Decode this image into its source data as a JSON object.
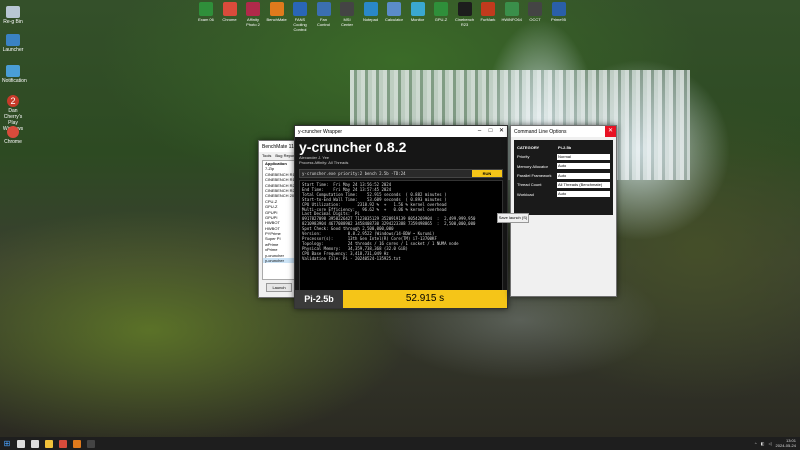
{
  "desktop": {
    "left_icons": [
      {
        "label": "Re-g Bin",
        "icon": "recycle-bin-icon",
        "color": "#b8c7d4"
      },
      {
        "label": "Launcher",
        "icon": "launcher-icon",
        "color": "#3a82c4"
      },
      {
        "label": "Notification",
        "icon": "notification-icon",
        "color": "#4a9ed6"
      },
      {
        "label": "Dan Cherry's Play Windows 2",
        "icon": "number-2-icon",
        "color": "#c83a2a"
      },
      {
        "label": "Chrome",
        "icon": "chrome-icon",
        "color": "#d94b3b"
      }
    ],
    "top_icons": [
      {
        "label": "Exam 06",
        "color": "#2f8f3a"
      },
      {
        "label": "Chrome",
        "color": "#d94b3b"
      },
      {
        "label": "Affinity Photo 2",
        "color": "#b02a4a"
      },
      {
        "label": "BenchMate",
        "color": "#e07a1c"
      },
      {
        "label": "FANS Cooling Control",
        "color": "#2a66b8"
      },
      {
        "label": "Fan Control",
        "color": "#3b6fb0"
      },
      {
        "label": "MSI Center",
        "color": "#444"
      },
      {
        "label": "Notepad",
        "color": "#2a88c8"
      },
      {
        "label": "Calculator",
        "color": "#5b8cc8"
      },
      {
        "label": "Monitor",
        "color": "#3aa8d0"
      },
      {
        "label": "GPU-Z",
        "color": "#2f8f3a"
      },
      {
        "label": "Cinebench R23",
        "color": "#1d1d1d"
      },
      {
        "label": "FurMark",
        "color": "#c23a1d"
      },
      {
        "label": "HWiNFO64",
        "color": "#3a8f4a"
      },
      {
        "label": "OCCT",
        "color": "#444"
      },
      {
        "label": "Prime95",
        "color": "#2a5fa8"
      }
    ]
  },
  "benchmate": {
    "title": "BenchMate 11",
    "menu": [
      "Tools",
      "Bug Report"
    ],
    "list_header": "Application",
    "items": [
      "7-Zip",
      "CINEBENCH R11.5",
      "CINEBENCH R15",
      "CINEBENCH R20",
      "CINEBENCH R23",
      "CINEBENCH 2024",
      "CPU-Z",
      "GPU-Z",
      "GPUPI",
      "GPUPI",
      "HWBOT",
      "HWBOT",
      "PYPrime",
      "Super PI",
      "wPrime",
      "xPrime",
      "y-cruncher",
      "y-cruncher"
    ],
    "launch_label": "Launch"
  },
  "ycruncher": {
    "window_title": "y-cruncher Wrapper",
    "title": "y-cruncher 0.8.2",
    "sub1": "Alexander J. Yee",
    "sub2": "Process Affinity: All Threads",
    "command": "y-cruncher.exe priority:2 bench 2.5b -TD:24",
    "run_label": "RUN",
    "console": [
      "Start Time:  Fri May 24 13:56:52 2024",
      "End Time:    Fri May 24 13:57:45 2024",
      "",
      "Total Computation Time:    52.915 seconds  ( 0.882 minutes )",
      "Start-to-End Wall Time:    53.609 seconds  ( 0.893 minutes )",
      "",
      "CPU Utilization:       2318.92 %  +   1.56 % kernel overhead",
      "Multi-core Efficiency:   96.62 %  +   0.06 % kernel overhead",
      "",
      "Last Decimal Digits:  Pi",
      "0917827098 3958226427 7123035129 3520919139 8054269904  :  2,499,999,950",
      "8210983904 4677088902 3458408730 3294223388 7359498865  :  2,500,000,000",
      "",
      "Spot Check: Good through 2,500,000,000",
      "",
      "Version:           0.8.2.9522 (Windows/14-BDW ~ Kurumi)",
      "Processor(s):      13th Gen Intel(R) Core(TM) i7-13700KF",
      "Topology:          24 threads / 16 cores / 1 socket / 1 NUMA node",
      "Physical Memory:   34,359,738,368 (32.0 GiB)",
      "CPU Base Frequency: 3,418,731,049 Hz",
      "",
      "Validation File: Pi - 20240524-135925.txt"
    ],
    "result_label": "Pi-2.5b",
    "result_value": "52.915 s"
  },
  "cmdopts": {
    "title": "Command Line Options",
    "header_key": "CATEGORY",
    "header_value": "Pi-2.5b",
    "rows": [
      {
        "key": "Priority",
        "value": "Normal"
      },
      {
        "key": "Memory Allocator",
        "value": "Auto"
      },
      {
        "key": "Parallel Framework",
        "value": "Auto"
      },
      {
        "key": "Thread Count",
        "value": "All Threads (Benchmate)"
      },
      {
        "key": "Workload",
        "value": "Auto"
      }
    ],
    "extra_button": "Save launch (S)"
  },
  "taskbar": {
    "items": [
      {
        "name": "search-icon",
        "color": "#dddddd"
      },
      {
        "name": "task-view-icon",
        "color": "#dddddd"
      },
      {
        "name": "explorer-icon",
        "color": "#f2c23a"
      },
      {
        "name": "chrome-icon",
        "color": "#d94b3b"
      },
      {
        "name": "benchmate-icon",
        "color": "#e07a1c"
      },
      {
        "name": "ycruncher-icon",
        "color": "#444444"
      }
    ],
    "time": "13:01",
    "date": "2024-05-24"
  }
}
